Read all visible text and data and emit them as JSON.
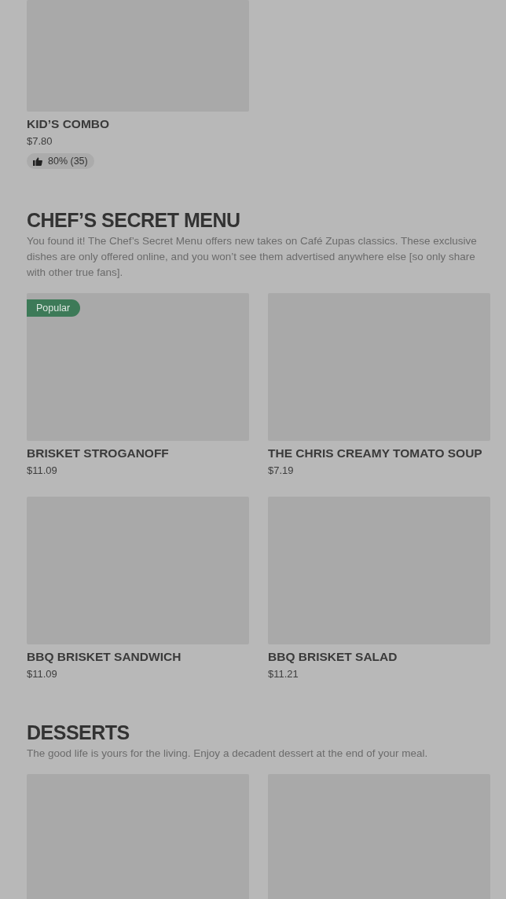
{
  "sections": [
    {
      "items": [
        {
          "kind": "dish",
          "name": "KID’S COMBO",
          "price": "$7.80",
          "rating": "80% (35)"
        }
      ]
    },
    {
      "title": "CHEF’S SECRET MENU",
      "description": "You found it! The Chef’s Secret Menu offers new takes on Café Zupas classics. These exclusive dishes are only offered online, and you won’t see them advertised anywhere else [so only share with other true fans].",
      "items": [
        {
          "kind": "dish",
          "name": "BRISKET STROGANOFF",
          "price": "$11.09",
          "badge": "Popular"
        },
        {
          "kind": "dish",
          "name": "THE CHRIS CREAMY TOMATO SOUP",
          "price": "$7.19"
        },
        {
          "kind": "dish",
          "name": "BBQ BRISKET SANDWICH",
          "price": "$11.09"
        },
        {
          "kind": "dish",
          "name": "BBQ BRISKET SALAD",
          "price": "$11.21"
        }
      ]
    },
    {
      "title": "DESSERTS",
      "description": "The good life is yours for the living. Enjoy a decadent dessert at the end of your meal.",
      "items": [
        {
          "kind": "image-only"
        },
        {
          "kind": "image-only"
        }
      ]
    }
  ]
}
